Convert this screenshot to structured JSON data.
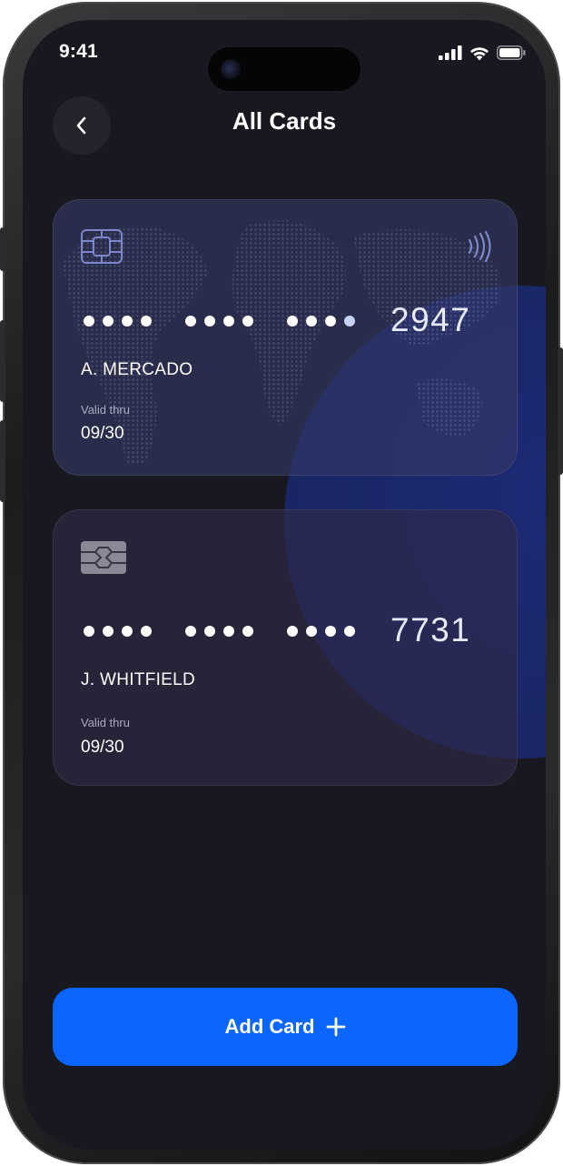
{
  "status_bar": {
    "time": "9:41"
  },
  "header": {
    "title": "All Cards",
    "back_icon": "chevron-left-icon"
  },
  "cards": [
    {
      "masked_groups": [
        "••••",
        "••••",
        "••••"
      ],
      "last4": "2947",
      "holder": "A. MERCADO",
      "valid_label": "Valid thru",
      "valid_value": "09/30",
      "chip_icon": "chip-icon",
      "contactless_icon": "contactless-icon"
    },
    {
      "masked_groups": [
        "••••",
        "••••",
        "••••"
      ],
      "last4": "7731",
      "holder": "J. WHITFIELD",
      "valid_label": "Valid thru",
      "valid_value": "09/30",
      "chip_icon": "chip-icon"
    }
  ],
  "actions": {
    "add_card_label": "Add Card",
    "add_icon": "plus-icon"
  },
  "colors": {
    "background": "#181820",
    "accent": "#0a66ff",
    "glow": "#1e2e8a"
  }
}
